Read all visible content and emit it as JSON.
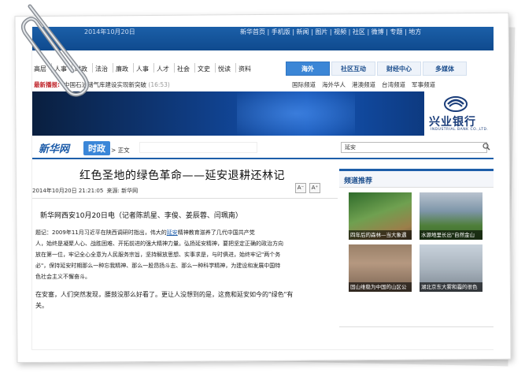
{
  "topbar": {
    "date": "2014年10月20日",
    "links": "新华首页 | 手机版 | 新闻 | 图片 | 视频 | 社区 | 微博 | 专题 | 地方"
  },
  "nav": {
    "items": [
      "高层",
      "人事",
      "时政",
      "法治",
      "廉政",
      "人事",
      "人才",
      "社会",
      "文史",
      "悦读",
      "资料"
    ]
  },
  "side_tabs": [
    "海外",
    "社区互动",
    "财经中心",
    "多媒体"
  ],
  "flash": {
    "label": "最新播报:",
    "text": "中国石油储气库建设实现新突破",
    "time": "(16:53)"
  },
  "sub_nav": [
    "国际频道",
    "海外华人",
    "港澳频道",
    "台湾频道",
    "军事频道"
  ],
  "bank": {
    "name": "兴业银行",
    "en": "INDUSTRIAL BANK CO.,LTD.",
    "color": "#1a3d7a"
  },
  "brand": {
    "logo": "新华网",
    "section": "时政",
    "crumb": "> 正文"
  },
  "search": {
    "value": "延安"
  },
  "article": {
    "title": "红色圣地的绿色革命——延安退耕还林记",
    "date": "2014年10月20日 21:21:05",
    "source": "来源: 新华网",
    "font_small": "A⁻",
    "font_large": "A⁺",
    "lead": "新华网西安10月20日电（记者陈凯星、李俊、姜辰蓉、闫珮南）",
    "paragraphs": [
      {
        "pre": "    题记：2009年11月习近平在陕西调研时指出，伟大的",
        "kw": "延安",
        "post": "精神教育滋养了几代中国共产党"
      },
      {
        "pre": "人，始终是凝聚人心、战胜困难、开拓前进的强大精神力量。弘扬延安精神，要把坚定正确的政治方向",
        "kw": "",
        "post": ""
      },
      {
        "pre": "放在第一位，牢记全心全意为人民服务宗旨，坚持解放思想、实事求是，与时俱进，始终牢记\"两个务",
        "kw": "",
        "post": ""
      },
      {
        "pre": "必\"，保持延安时期那么一种忘我精神、那么一股昂扬斗志、那么一种科学精神，为建设和发展中国特",
        "kw": "",
        "post": ""
      },
      {
        "pre": "色社会主义不懈奋斗。",
        "kw": "",
        "post": ""
      }
    ],
    "body": "    在安塞，人们突然发现，腰鼓没那么好看了。更让人没想到的是，这竟和延安如今的\"绿色\"有",
    "body2": "关。"
  },
  "right": {
    "title": "频道推荐",
    "thumbs": [
      {
        "caption": "四年后的森林—当大象遇"
      },
      {
        "caption": "水源地里长出\"自然金山"
      },
      {
        "caption": "固山维稳为中国的山区公"
      },
      {
        "caption": "湖北京东大雾和霾的很色"
      }
    ]
  },
  "colors": {
    "brand_blue": "#1d5ea9",
    "accent_red": "#c0252b"
  }
}
